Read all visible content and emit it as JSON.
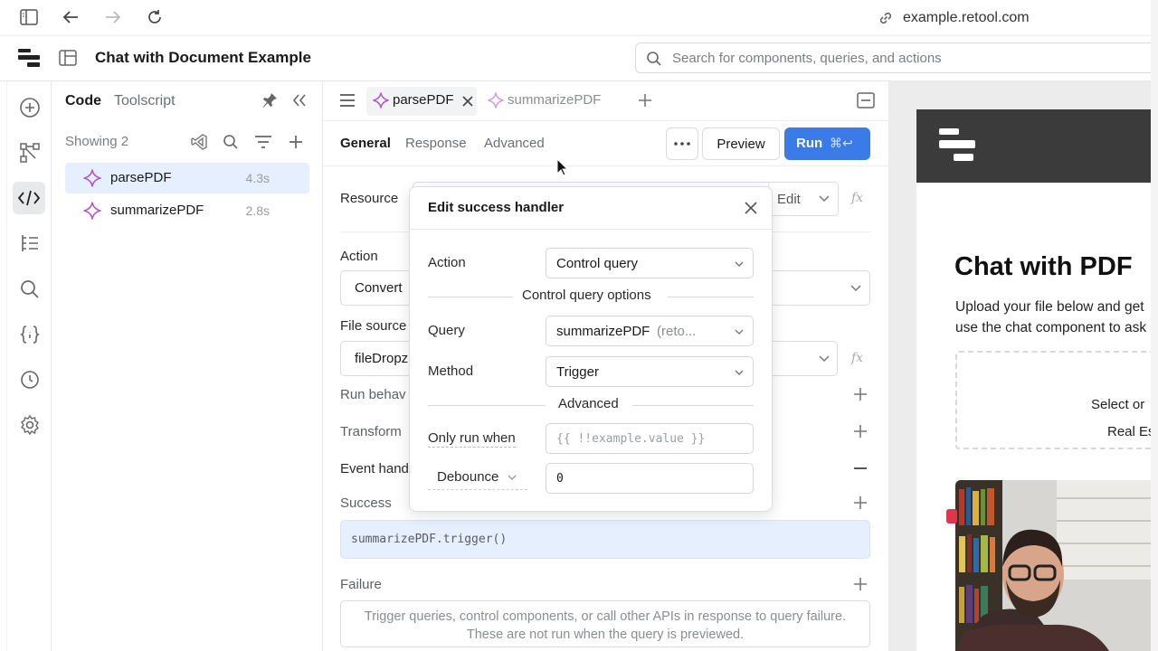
{
  "browser": {
    "url": "example.retool.com"
  },
  "header": {
    "title": "Chat with Document Example",
    "search_placeholder": "Search for components, queries, and actions"
  },
  "code_panel": {
    "tabs": [
      "Code",
      "Toolscript"
    ],
    "showing": "Showing 2",
    "queries": [
      {
        "name": "parsePDF",
        "time": "4.3s"
      },
      {
        "name": "summarizePDF",
        "time": "2.8s"
      }
    ]
  },
  "editor": {
    "tabs": [
      "parsePDF",
      "summarizePDF"
    ],
    "subtabs": [
      "General",
      "Response",
      "Advanced"
    ],
    "preview_label": "Preview",
    "run_label": "Run",
    "run_shortcut": "⌘↩",
    "resource_label": "Resource",
    "edit_label": "Edit",
    "action_label": "Action",
    "action_value": "Convert",
    "file_source_label": "File source",
    "file_source_value": "fileDropz",
    "run_behavior_label": "Run behav",
    "transform_label": "Transform",
    "event_handlers_label": "Event hand",
    "success_label": "Success",
    "success_handler": "summarizePDF.trigger()",
    "failure_label": "Failure",
    "failure_help": "Trigger queries, control components, or call other APIs in response to query failure. These are not run when the query is previewed."
  },
  "modal": {
    "title": "Edit success handler",
    "action_label": "Action",
    "action_value": "Control query",
    "options_title": "Control query options",
    "query_label": "Query",
    "query_value": "summarizePDF",
    "query_suffix": "(reto...",
    "method_label": "Method",
    "method_value": "Trigger",
    "advanced_title": "Advanced",
    "only_run_label": "Only run when",
    "only_run_placeholder": "{{ !!example.value }}",
    "debounce_label": "Debounce",
    "debounce_value": "0"
  },
  "preview_app": {
    "title": "Chat with PDF",
    "description_line1": "Upload your file below and get",
    "description_line2": "use the chat component to ask",
    "drop_line1": "Select or",
    "drop_line2": "Real Es"
  },
  "colors": {
    "accent": "#3a7be8",
    "query_icon": "#b455c8",
    "selected_row": "#e6effd"
  }
}
